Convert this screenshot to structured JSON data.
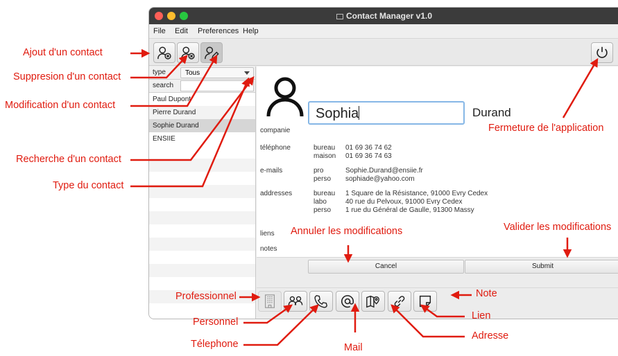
{
  "window": {
    "title": "Contact Manager v1.0"
  },
  "menu": [
    "File",
    "Edit",
    "Preferences",
    "Help"
  ],
  "toolbar": {
    "add_icon": "person-add-icon",
    "delete_icon": "person-remove-icon",
    "edit_icon": "person-edit-icon",
    "quit_icon": "power-icon"
  },
  "left": {
    "type_label": "type",
    "type_value": "Tous",
    "search_label": "search",
    "search_value": "",
    "contacts": [
      "Paul Dupont",
      "Pierre Durand",
      "Sophie Durand",
      "ENSIIE"
    ],
    "selected": "Sophie Durand"
  },
  "detail": {
    "first_name": "Sophia",
    "last_name": "Durand",
    "labels": {
      "company": "companie",
      "phone": "téléphone",
      "emails": "e-mails",
      "addresses": "addresses",
      "links": "liens",
      "notes": "notes"
    },
    "phones": [
      {
        "kind": "bureau",
        "value": "01 69 36 74 62"
      },
      {
        "kind": "maison",
        "value": "01 69 36 74 63"
      }
    ],
    "emails": [
      {
        "kind": "pro",
        "value": "Sophie.Durand@ensiie.fr"
      },
      {
        "kind": "perso",
        "value": "sophiade@yahoo.com"
      }
    ],
    "addresses": [
      {
        "kind": "bureau",
        "value": "1 Square de la Résistance, 91000 Evry Cedex"
      },
      {
        "kind": "labo",
        "value": "40 rue du Pelvoux, 91000 Evry Cedex"
      },
      {
        "kind": "perso",
        "value": "1 rue du Général de Gaulle, 91300 Massy"
      }
    ],
    "cancel": "Cancel",
    "submit": "Submit"
  },
  "bottom_icons": [
    "building-icon",
    "people-icon",
    "phone-icon",
    "at-icon",
    "map-pin-icon",
    "link-icon",
    "note-icon"
  ],
  "annotations": {
    "add": "Ajout d'un contact",
    "delete": "Suppresion d'un contact",
    "edit": "Modification d'un contact",
    "search": "Recherche d'un contact",
    "type": "Type du contact",
    "quit": "Fermeture de l'application",
    "cancel": "Annuler les modifications",
    "submit": "Valider les modifications",
    "pro": "Professionnel",
    "perso": "Personnel",
    "phone": "Télephone",
    "mail": "Mail",
    "address": "Adresse",
    "link": "Lien",
    "note": "Note"
  },
  "colors": {
    "annotation": "#e01b0f",
    "titlebar": "#3b3b3b",
    "focus": "#86b7e6"
  }
}
